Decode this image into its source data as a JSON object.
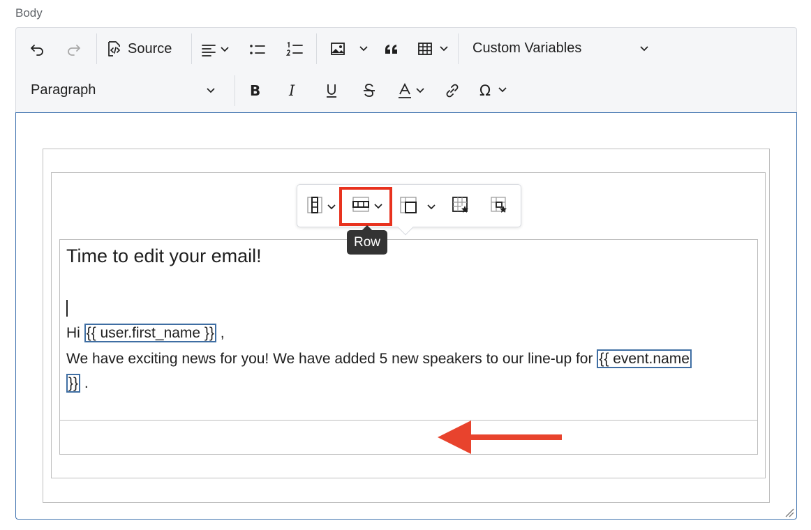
{
  "field": {
    "label": "Body"
  },
  "toolbar": {
    "source_label": "Source",
    "custom_variables_label": "Custom Variables",
    "paragraph_label": "Paragraph",
    "icons": [
      "undo-icon",
      "redo-icon",
      "source-icon",
      "align-left-icon",
      "bulleted-list-icon",
      "numbered-list-icon",
      "image-icon",
      "block-quote-icon",
      "table-icon",
      "bold-icon",
      "italic-icon",
      "underline-icon",
      "strikethrough-icon",
      "font-color-icon",
      "link-icon",
      "special-characters-icon"
    ]
  },
  "table_toolbar": {
    "icons": [
      "table-column-icon",
      "table-row-icon",
      "merge-cells-icon",
      "table-properties-icon",
      "cell-properties-icon"
    ],
    "tooltip": "Row"
  },
  "content": {
    "heading": "Time to edit your email!",
    "greeting_prefix": "Hi ",
    "greeting_var": "{{ user.first_name }}",
    "greeting_suffix": " ,",
    "body_text": "We have exciting news for you! We have added 5 new speakers to our line-up for ",
    "body_var_part1": "{{ event.name",
    "body_var_part2": "}}",
    "body_suffix": " ."
  },
  "colors": {
    "highlight": "#e8321e",
    "arrow": "#e8432d",
    "variable_border": "#3f6ea3",
    "focus_border": "#3f72af"
  }
}
